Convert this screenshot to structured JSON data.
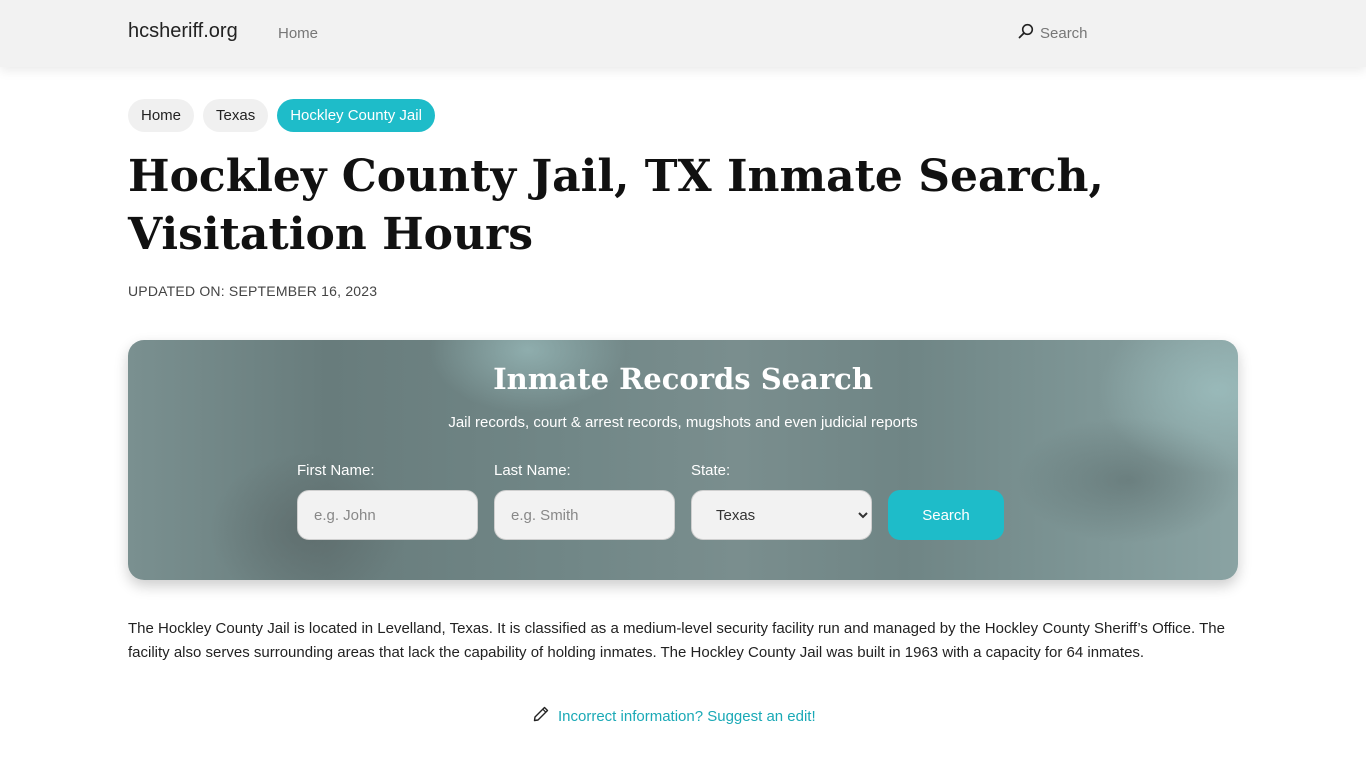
{
  "navbar": {
    "brand": "hcsheriff.org",
    "links": [
      {
        "label": "Home"
      }
    ],
    "search_label": "Search",
    "search_icon": "search-icon"
  },
  "breadcrumb": [
    {
      "label": "Home",
      "active": false
    },
    {
      "label": "Texas",
      "active": false
    },
    {
      "label": "Hockley County Jail",
      "active": true
    }
  ],
  "page": {
    "title": "Hockley County Jail, TX Inmate Search, Visitation Hours",
    "updated": "UPDATED ON: SEPTEMBER 16, 2023"
  },
  "search_card": {
    "title": "Inmate Records Search",
    "subtitle": "Jail records, court & arrest records, mugshots and even judicial reports",
    "first_name": {
      "label": "First Name:",
      "placeholder": "e.g. John",
      "value": ""
    },
    "last_name": {
      "label": "Last Name:",
      "placeholder": "e.g. Smith",
      "value": ""
    },
    "state": {
      "label": "State:",
      "selected": "Texas"
    },
    "button_label": "Search"
  },
  "description": "The Hockley County Jail is located in Levelland, Texas. It is classified as a medium-level security facility run and managed by the Hockley County Sheriff’s Office. The facility also serves surrounding areas that lack the capability of holding inmates. The Hockley County Jail was built in 1963 with a capacity for 64 inmates.",
  "edit_link": {
    "label": "Incorrect information? Suggest an edit!",
    "icon": "pencil-icon"
  },
  "colors": {
    "accent": "#1ebcc9",
    "link": "#1aa9b6",
    "navbar_bg": "#f2f2f2"
  }
}
